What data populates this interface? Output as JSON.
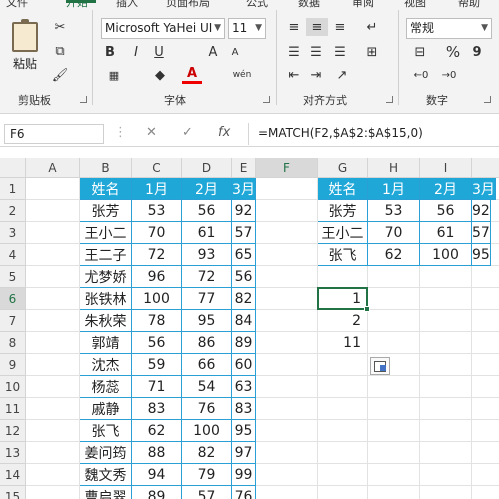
{
  "ribbon": {
    "tabs": [
      "文件",
      "开始",
      "插入",
      "页面布局",
      "公式",
      "数据",
      "审阅",
      "视图",
      "帮助"
    ],
    "clipboard": {
      "paste_label": "粘贴",
      "group_label": "剪贴板"
    },
    "font": {
      "name": "Microsoft YaHei UI",
      "size": "11",
      "group_label": "字体",
      "bold": "B",
      "italic": "I",
      "underline": "U",
      "grow": "A",
      "shrink": "A",
      "font_color": "A",
      "wen": "wén"
    },
    "alignment": {
      "group_label": "对齐方式"
    },
    "number": {
      "format": "常规",
      "group_label": "数字",
      "percent": "%",
      "comma": "9"
    }
  },
  "formula_bar": {
    "name_box": "F6",
    "cancel": "✕",
    "enter": "✓",
    "fx": "fx",
    "formula": "=MATCH(F2,$A$2:$A$15,0)"
  },
  "columns": [
    "A",
    "B",
    "C",
    "D",
    "E",
    "F",
    "G",
    "H",
    "I"
  ],
  "rows": [
    "1",
    "2",
    "3",
    "4",
    "5",
    "6",
    "7",
    "8",
    "9",
    "10",
    "11",
    "12",
    "13",
    "14",
    "15"
  ],
  "left_table": {
    "headers": [
      "姓名",
      "1月",
      "2月",
      "3月"
    ],
    "data": [
      [
        "张芳",
        "53",
        "56",
        "92"
      ],
      [
        "王小二",
        "70",
        "61",
        "57"
      ],
      [
        "王二子",
        "72",
        "93",
        "65"
      ],
      [
        "尤梦娇",
        "96",
        "72",
        "56"
      ],
      [
        "张铁林",
        "100",
        "77",
        "82"
      ],
      [
        "朱秋荣",
        "78",
        "95",
        "84"
      ],
      [
        "郭靖",
        "56",
        "86",
        "89"
      ],
      [
        "沈杰",
        "59",
        "66",
        "60"
      ],
      [
        "杨蕊",
        "71",
        "54",
        "63"
      ],
      [
        "戚静",
        "83",
        "76",
        "83"
      ],
      [
        "张飞",
        "62",
        "100",
        "95"
      ],
      [
        "姜问筠",
        "88",
        "82",
        "97"
      ],
      [
        "魏文秀",
        "94",
        "79",
        "99"
      ],
      [
        "曹启翠",
        "89",
        "57",
        "76"
      ]
    ]
  },
  "right_table": {
    "headers": [
      "姓名",
      "1月",
      "2月",
      "3月"
    ],
    "data": [
      [
        "张芳",
        "53",
        "56",
        "92"
      ],
      [
        "王小二",
        "70",
        "61",
        "57"
      ],
      [
        "张飞",
        "62",
        "100",
        "95"
      ]
    ]
  },
  "results": [
    "1",
    "2",
    "11"
  ],
  "colors": {
    "header_fill": "#1fa7d8",
    "border": "#2a9fd6",
    "accent": "#217346"
  }
}
